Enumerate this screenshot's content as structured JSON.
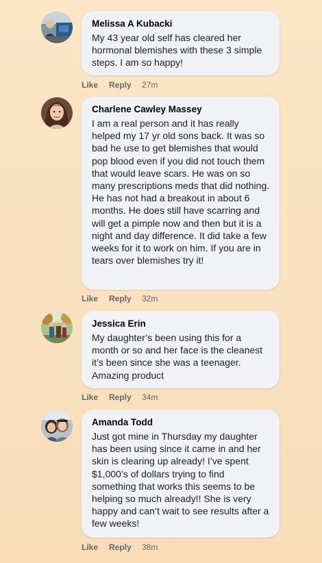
{
  "comments": [
    {
      "author": "Melissa A Kubacki",
      "text": "My 43 year old self has cleared her hormonal blemishes with these 3 simple steps. I am so happy!",
      "like": "Like",
      "reply": "Reply",
      "time": "27m"
    },
    {
      "author": "Charlene Cawley Massey",
      "text": "I am a real person and it has really helped my 17 yr old sons back. It was so bad he use to get blemishes that would pop blood even if you did not touch them that would leave scars. He was on so many prescriptions meds that did nothing. He has not had a breakout in about 6 months. He does still have scarring and will get a pimple now and then but it is a night and day difference. It did take a few weeks for it to work on him. If you are in tears over blemishes try it!",
      "like": "Like",
      "reply": "Reply",
      "time": "32m"
    },
    {
      "author": "Jessica Erin",
      "text": "My daughter’s been using this for a month or so and her face is the cleanest it’s been since she was a teenager. Amazing product",
      "like": "Like",
      "reply": "Reply",
      "time": "34m"
    },
    {
      "author": "Amanda Todd",
      "text": "Just got mine in Thursday my daughter has been using since it came in and her skin is clearing up already! I’ve spent $1,000’s of dollars trying to find something that works this seems to be helping so much already!! She is very happy and can’t wait to see results after a few weeks!",
      "like": "Like",
      "reply": "Reply",
      "time": "38m"
    }
  ]
}
